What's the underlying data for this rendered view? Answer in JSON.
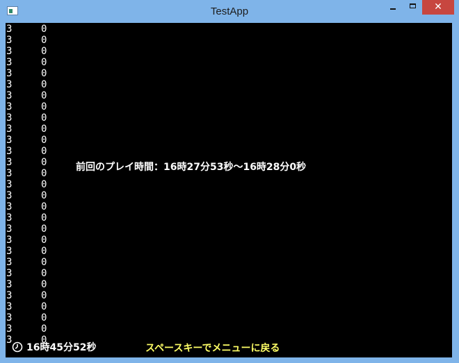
{
  "window": {
    "title": "TestApp",
    "icon": "console-app-icon",
    "controls": {
      "minimize_icon": "minimize-icon",
      "maximize_icon": "maximize-icon",
      "close_glyph": "✕"
    }
  },
  "console": {
    "left_column": [
      "3",
      "3",
      "3",
      "3",
      "3",
      "3",
      "3",
      "3",
      "3",
      "3",
      "3",
      "3",
      "3",
      "3",
      "3",
      "3",
      "3",
      "3",
      "3",
      "3",
      "3",
      "3",
      "3",
      "3",
      "3",
      "3",
      "3",
      "3",
      "3"
    ],
    "right_column": [
      "0",
      "0",
      "0",
      "0",
      "0",
      "0",
      "0",
      "0",
      "0",
      "0",
      "0",
      "0",
      "0",
      "0",
      "0",
      "0",
      "0",
      "0",
      "0",
      "0",
      "0",
      "0",
      "0",
      "0",
      "0",
      "0",
      "0",
      "0",
      "0"
    ],
    "message": "前回のプレイ時間：16時27分53秒～16時28分0秒",
    "clock_icon": "clock-icon",
    "current_time": "16時45分52秒",
    "hint": "スペースキーでメニューに戻る"
  },
  "colors": {
    "frame": "#7fb4e9",
    "console_bg": "#000000",
    "text": "#ffffff",
    "hint": "#ffff66",
    "close_button": "#c7463f"
  }
}
